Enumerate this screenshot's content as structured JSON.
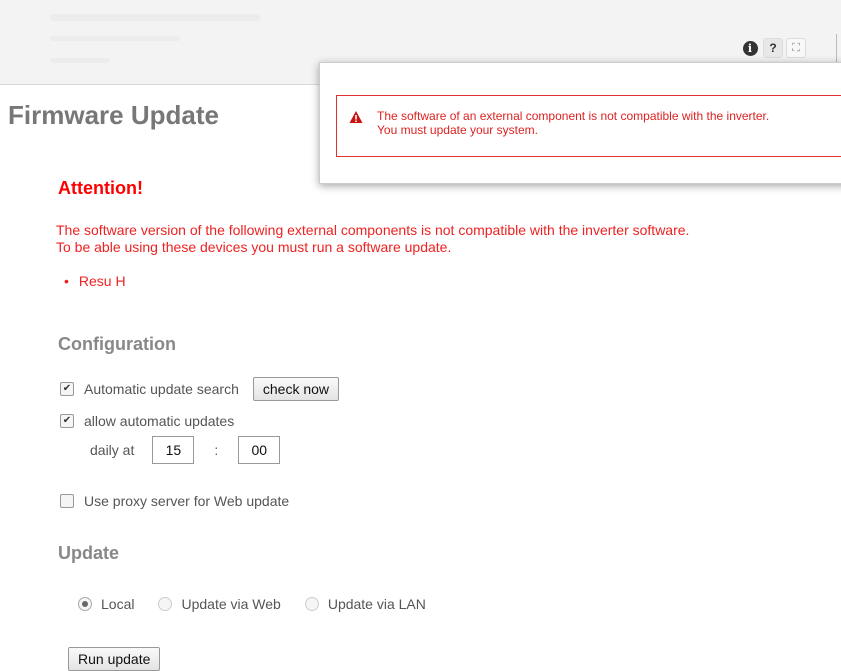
{
  "header": {
    "info_glyph": "i",
    "help_glyph": "?",
    "fullscreen_glyph": "⛶"
  },
  "page_title": "Firmware Update",
  "popup": {
    "line1": "The software of an external component is not compatible with the inverter.",
    "line2": "You must update your system.",
    "color": "#e03030"
  },
  "attention": {
    "title": "Attention!",
    "line1": "The software version of the following external components is not compatible with the inverter software.",
    "line2": "To be able using these devices you must run a software update.",
    "components": [
      "Resu H"
    ],
    "color": "#ee2222"
  },
  "configuration": {
    "heading": "Configuration",
    "auto_search_label": "Automatic update search",
    "auto_search_checked": true,
    "check_now_label": "check now",
    "allow_updates_label": "allow automatic updates",
    "allow_updates_checked": true,
    "daily_at_label": "daily at",
    "hour": "15",
    "separator": ":",
    "minute": "00",
    "proxy_label": "Use proxy server for Web update",
    "proxy_checked": false
  },
  "update": {
    "heading": "Update",
    "options": [
      {
        "label": "Local",
        "selected": true
      },
      {
        "label": "Update via Web",
        "selected": false
      },
      {
        "label": "Update via LAN",
        "selected": false
      }
    ],
    "run_label": "Run update"
  }
}
